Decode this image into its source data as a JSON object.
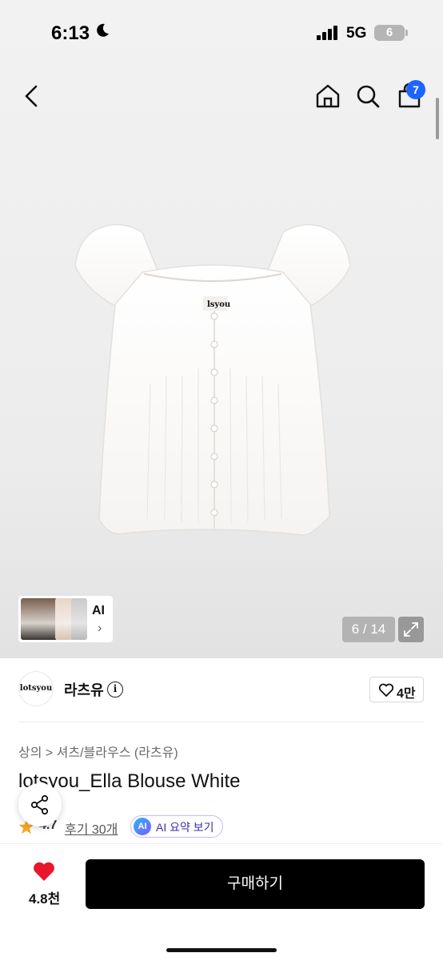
{
  "status_bar": {
    "time": "6:13",
    "network": "5G",
    "battery": "6"
  },
  "nav": {
    "cart_count": "7"
  },
  "gallery": {
    "thumb_label": "AI",
    "counter": "6 / 14",
    "garment_label": "lsyou"
  },
  "brand": {
    "logo_text": "lotsyou",
    "name": "라츠유",
    "likes": "4만"
  },
  "product": {
    "breadcrumb": "상의 > 셔츠/블라우스 (라츠유)",
    "title": "lotsyou_Ella Blouse White",
    "rating": "4.7",
    "reviews": "후기 30개",
    "ai_badge": "AI",
    "ai_summary": "AI 요약 보기"
  },
  "bottom_bar": {
    "wishlist_count": "4.8천",
    "buy_label": "구매하기"
  },
  "colors": {
    "accent_blue": "#1e64ff",
    "heart_red": "#e8172b",
    "buy_button": "#000000",
    "star": "#f5a623"
  }
}
